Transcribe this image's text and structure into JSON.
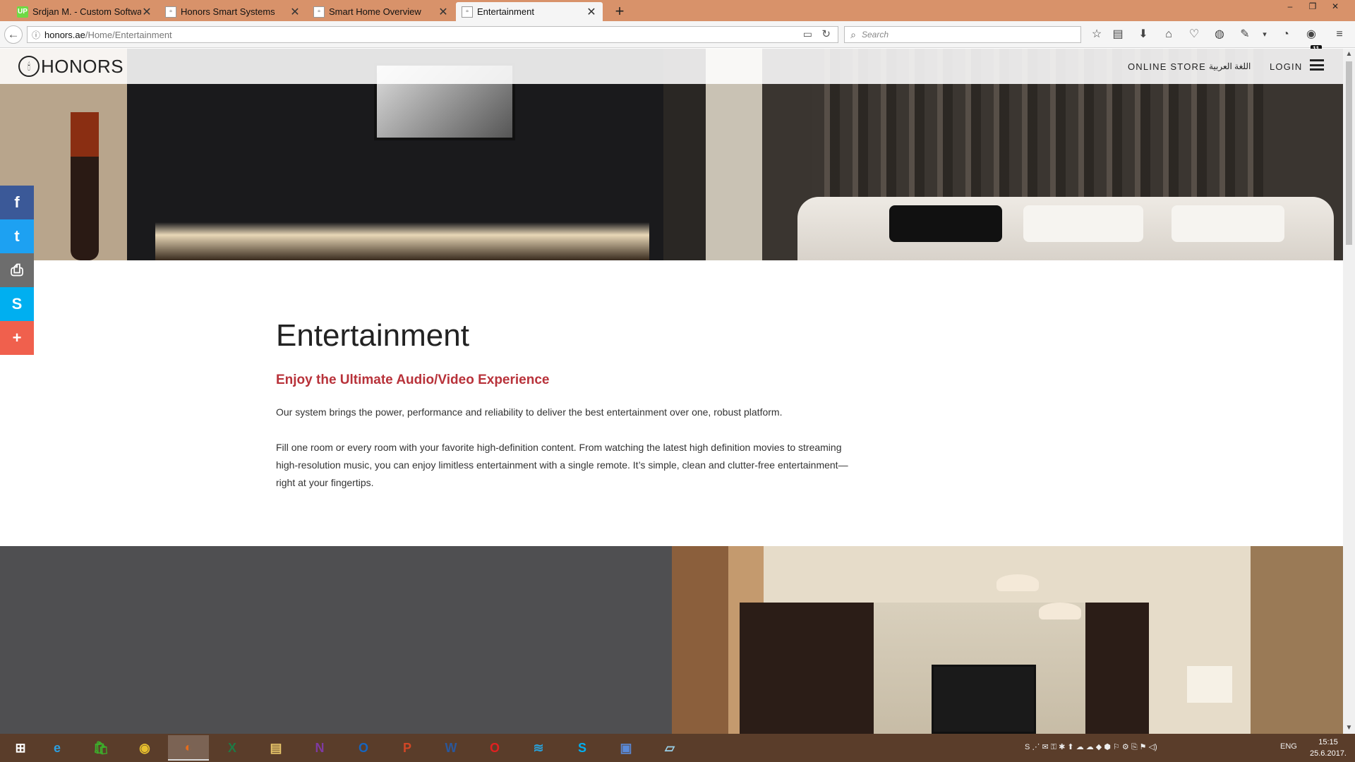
{
  "browser": {
    "tabs": [
      {
        "label": "Srdjan M. - Custom Software",
        "favicon": "UP",
        "active": false
      },
      {
        "label": "Honors Smart Systems",
        "favicon": "",
        "active": false
      },
      {
        "label": "Smart Home Overview",
        "favicon": "",
        "active": false
      },
      {
        "label": "Entertainment",
        "favicon": "",
        "active": true
      }
    ],
    "new_tab": "+",
    "url_domain": "honors.ae",
    "url_path": "/Home/Entertainment",
    "search_placeholder": "Search",
    "badge_count": "11"
  },
  "site": {
    "logo_text": "HONORS",
    "nav": {
      "online_store": "ONLINE STORE",
      "arabic": "اللغة العربية",
      "login": "LOGIN"
    },
    "social": [
      {
        "name": "facebook",
        "glyph": "f",
        "color": "#3b5998"
      },
      {
        "name": "twitter",
        "glyph": "t",
        "color": "#1da1f2"
      },
      {
        "name": "print",
        "glyph": "⎙",
        "color": "#6d6d6d"
      },
      {
        "name": "skype",
        "glyph": "S",
        "color": "#00aff0"
      },
      {
        "name": "more",
        "glyph": "+",
        "color": "#f0604d"
      }
    ],
    "heading": "Entertainment",
    "subheading": "Enjoy the Ultimate Audio/Video Experience",
    "paragraph1": "Our system brings the power, performance and reliability to deliver the best entertainment over one, robust platform.",
    "paragraph2": "Fill one room or every room with your favorite high-definition content. From watching the latest high definition movies to streaming high-resolution music, you can enjoy limitless entertainment with a single remote. It’s simple, clean and clutter-free entertainment—right at your fingertips.",
    "accent_color": "#b8323a"
  },
  "taskbar": {
    "apps": [
      {
        "name": "start",
        "glyph": "⊞",
        "color": "#ffffff"
      },
      {
        "name": "internet-explorer",
        "glyph": "e",
        "color": "#2d9fe0"
      },
      {
        "name": "store",
        "glyph": "🛍",
        "color": "#3dae2b"
      },
      {
        "name": "chrome",
        "glyph": "◉",
        "color": "#e8c02e"
      },
      {
        "name": "firefox",
        "glyph": "◐",
        "color": "#e66c1c"
      },
      {
        "name": "excel",
        "glyph": "X",
        "color": "#1f7a45"
      },
      {
        "name": "file-explorer",
        "glyph": "▤",
        "color": "#e8c66a"
      },
      {
        "name": "onenote",
        "glyph": "N",
        "color": "#7e3aa0"
      },
      {
        "name": "outlook",
        "glyph": "O",
        "color": "#1565c0"
      },
      {
        "name": "powerpoint",
        "glyph": "P",
        "color": "#d24726"
      },
      {
        "name": "word",
        "glyph": "W",
        "color": "#2b579a"
      },
      {
        "name": "opera",
        "glyph": "O",
        "color": "#e02020"
      },
      {
        "name": "chart-app",
        "glyph": "≋",
        "color": "#2aa0d8"
      },
      {
        "name": "skype",
        "glyph": "S",
        "color": "#00aff0"
      },
      {
        "name": "remote-desktop",
        "glyph": "▣",
        "color": "#5a8ad8"
      },
      {
        "name": "notes-app",
        "glyph": "▱",
        "color": "#9ad0e8"
      }
    ],
    "language": "ENG",
    "time": "15:15",
    "date": "25.6.2017."
  }
}
